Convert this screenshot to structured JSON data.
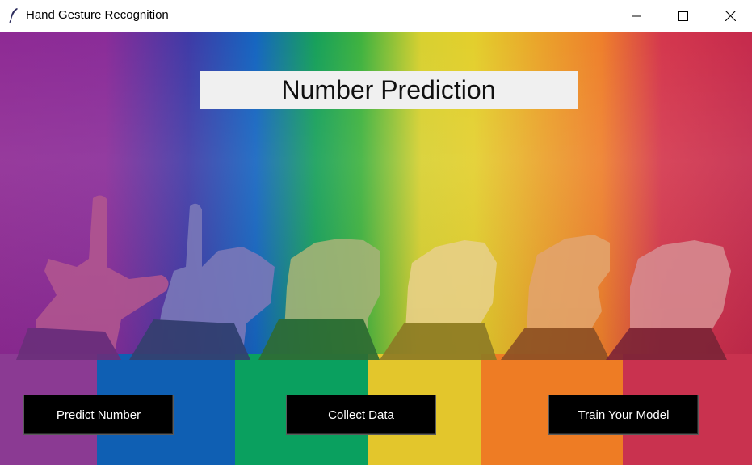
{
  "window": {
    "title": "Hand Gesture Recognition",
    "icon": "feather-icon",
    "controls": [
      "minimize-icon",
      "maximize-icon",
      "close-icon"
    ]
  },
  "main": {
    "heading": "Number Prediction",
    "background_stripe_colors": [
      "#8b3a93",
      "#0f5fb3",
      "#0aa05f",
      "#e3c62c",
      "#ee7c24",
      "#c9324f"
    ],
    "buttons": {
      "predict": "Predict Number",
      "collect": "Collect Data",
      "train": "Train Your Model"
    }
  }
}
